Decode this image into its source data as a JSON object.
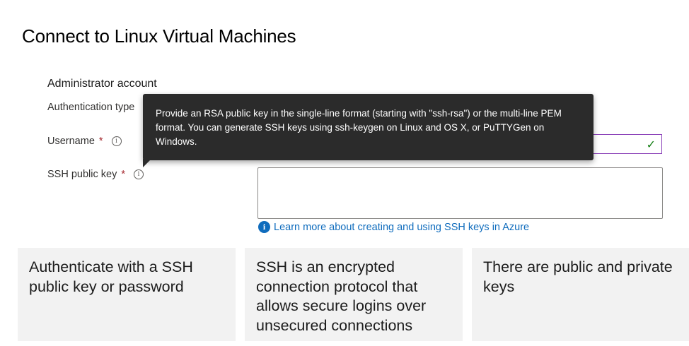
{
  "page": {
    "title": "Connect to Linux Virtual Machines"
  },
  "form": {
    "section_heading": "Administrator account",
    "auth_type_label": "Authentication type",
    "username_label": "Username",
    "ssh_key_label": "SSH public key",
    "required_marker": "*",
    "info_glyph": "i",
    "username_value": "",
    "ssh_key_value": "",
    "valid_check": "✓"
  },
  "tooltip": {
    "text": "Provide an RSA public key in the single-line format (starting with \"ssh-rsa\") or the multi-line PEM format. You can generate SSH keys using ssh-keygen on Linux and OS X, or PuTTYGen on Windows."
  },
  "link": {
    "icon_glyph": "i",
    "text": "Learn more about creating and using SSH keys in Azure"
  },
  "cards": [
    {
      "text": "Authenticate with a SSH public key or password"
    },
    {
      "text": "SSH is an encrypted connection protocol that allows secure logins over unsecured connections"
    },
    {
      "text": "There are public and private keys"
    }
  ],
  "colors": {
    "link_blue": "#0f6cbd",
    "tooltip_bg": "#2b2b2b",
    "focus_purple": "#8a41b8",
    "success_green": "#107c10",
    "required_red": "#a4262c",
    "card_bg": "#f2f2f2"
  }
}
